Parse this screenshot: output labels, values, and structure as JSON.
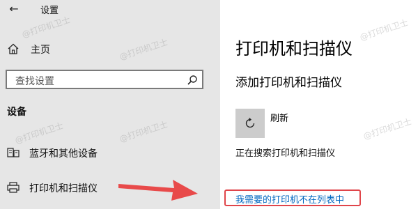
{
  "window": {
    "title": "设置",
    "back_icon": "back-arrow-icon"
  },
  "sidebar": {
    "home": {
      "label": "主页",
      "icon": "home-icon"
    },
    "search": {
      "placeholder": "查找设置",
      "icon": "search-icon"
    },
    "section_header": "设备",
    "items": [
      {
        "label": "蓝牙和其他设备",
        "icon": "bluetooth-devices-icon"
      },
      {
        "label": "打印机和扫描仪",
        "icon": "printer-icon"
      }
    ],
    "background_color": "#e6e6e6"
  },
  "main": {
    "title": "打印机和扫描仪",
    "subheading": "添加打印机和扫描仪",
    "refresh": {
      "label": "刷新",
      "icon": "refresh-icon"
    },
    "status": "正在搜索打印机和扫描仪",
    "link": "我需要的打印机不在列表中",
    "link_color": "#0067c0",
    "highlight_color": "#e0454a"
  },
  "watermark": "@打印机卫士"
}
